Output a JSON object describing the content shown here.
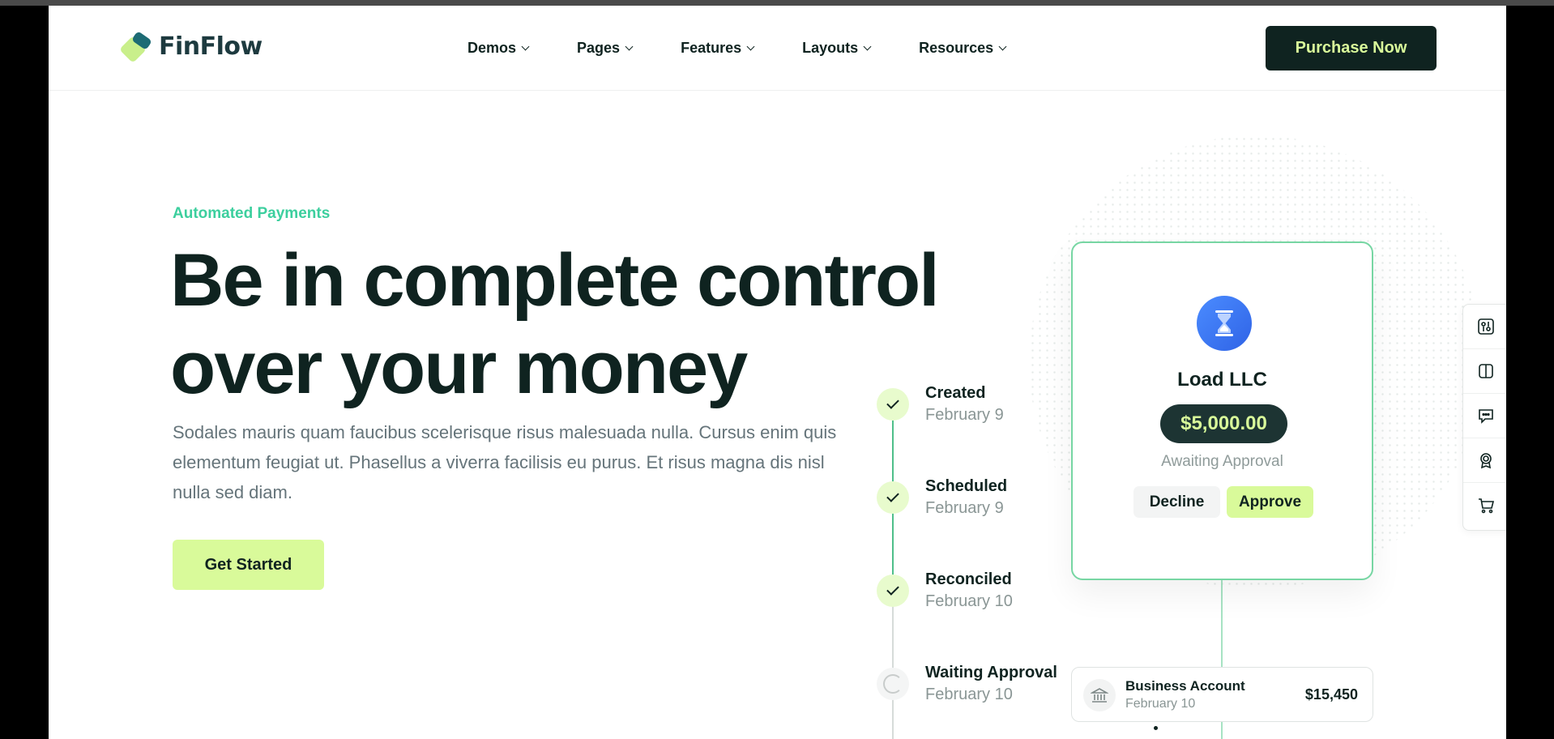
{
  "brand": {
    "name": "FinFlow"
  },
  "nav": {
    "items": [
      {
        "label": "Demos"
      },
      {
        "label": "Pages"
      },
      {
        "label": "Features"
      },
      {
        "label": "Layouts"
      },
      {
        "label": "Resources"
      }
    ],
    "cta_label": "Purchase Now"
  },
  "hero": {
    "eyebrow": "Automated Payments",
    "headline_line1": "Be in complete control",
    "headline_line2": "over your money",
    "lead": "Sodales mauris quam faucibus scelerisque risus malesuada nulla. Cursus enim quis elementum feugiat ut. Phasellus a viverra facilisis eu purus. Et risus magna dis nisl nulla sed diam.",
    "cta_label": "Get Started"
  },
  "timeline": [
    {
      "title": "Created",
      "date": "February 9",
      "status": "done"
    },
    {
      "title": "Scheduled",
      "date": "February 9",
      "status": "done"
    },
    {
      "title": "Reconciled",
      "date": "February 10",
      "status": "done"
    },
    {
      "title": "Waiting Approval",
      "date": "February 10",
      "status": "pending"
    }
  ],
  "payment_card": {
    "icon": "hourglass-icon",
    "name": "Load LLC",
    "amount": "$5,000.00",
    "status": "Awaiting Approval",
    "decline_label": "Decline",
    "approve_label": "Approve"
  },
  "account": {
    "icon": "bank-icon",
    "name": "Business Account",
    "date": "February 10",
    "amount": "$15,450"
  },
  "tool_rail": {
    "icons": [
      "settings-sliders-icon",
      "book-icon",
      "chat-icon",
      "badge-icon",
      "cart-icon"
    ]
  },
  "colors": {
    "dark": "#0f2320",
    "accent_lime": "#d9fa9a",
    "accent_green": "#3ccf9e",
    "muted_text": "#65747a"
  }
}
